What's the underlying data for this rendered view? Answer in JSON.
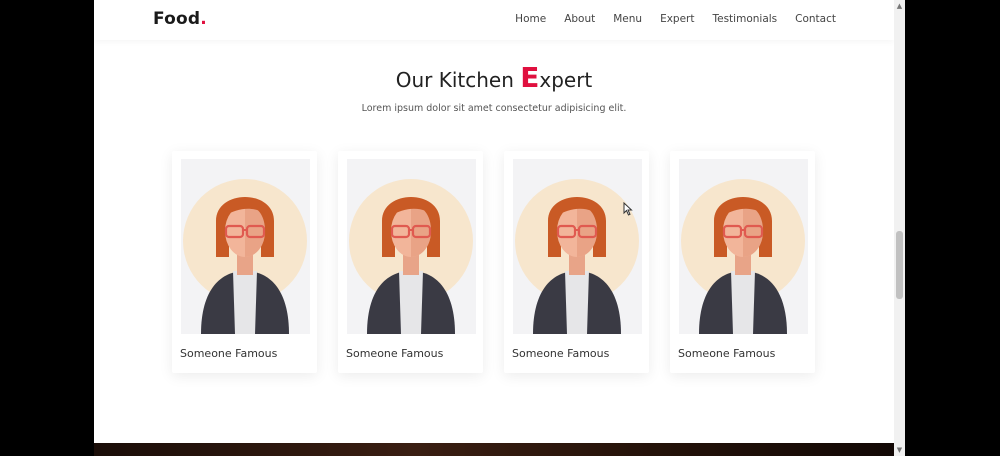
{
  "brand": {
    "name": "Food",
    "dot": "."
  },
  "nav": {
    "items": [
      "Home",
      "About",
      "Menu",
      "Expert",
      "Testimonials",
      "Contact"
    ]
  },
  "section": {
    "title_before": "Our Kitchen ",
    "title_highlight": "E",
    "title_after": "xpert",
    "subtitle": "Lorem ipsum dolor sit amet consectetur adipisicing elit."
  },
  "cards": [
    {
      "name": "Someone Famous"
    },
    {
      "name": "Someone Famous"
    },
    {
      "name": "Someone Famous"
    },
    {
      "name": "Someone Famous"
    }
  ],
  "colors": {
    "accent": "#e0103f",
    "hair": "#c95a25",
    "skin": "#f2b59a",
    "jacket": "#3a3a44",
    "halo": "#f7e6cd"
  }
}
